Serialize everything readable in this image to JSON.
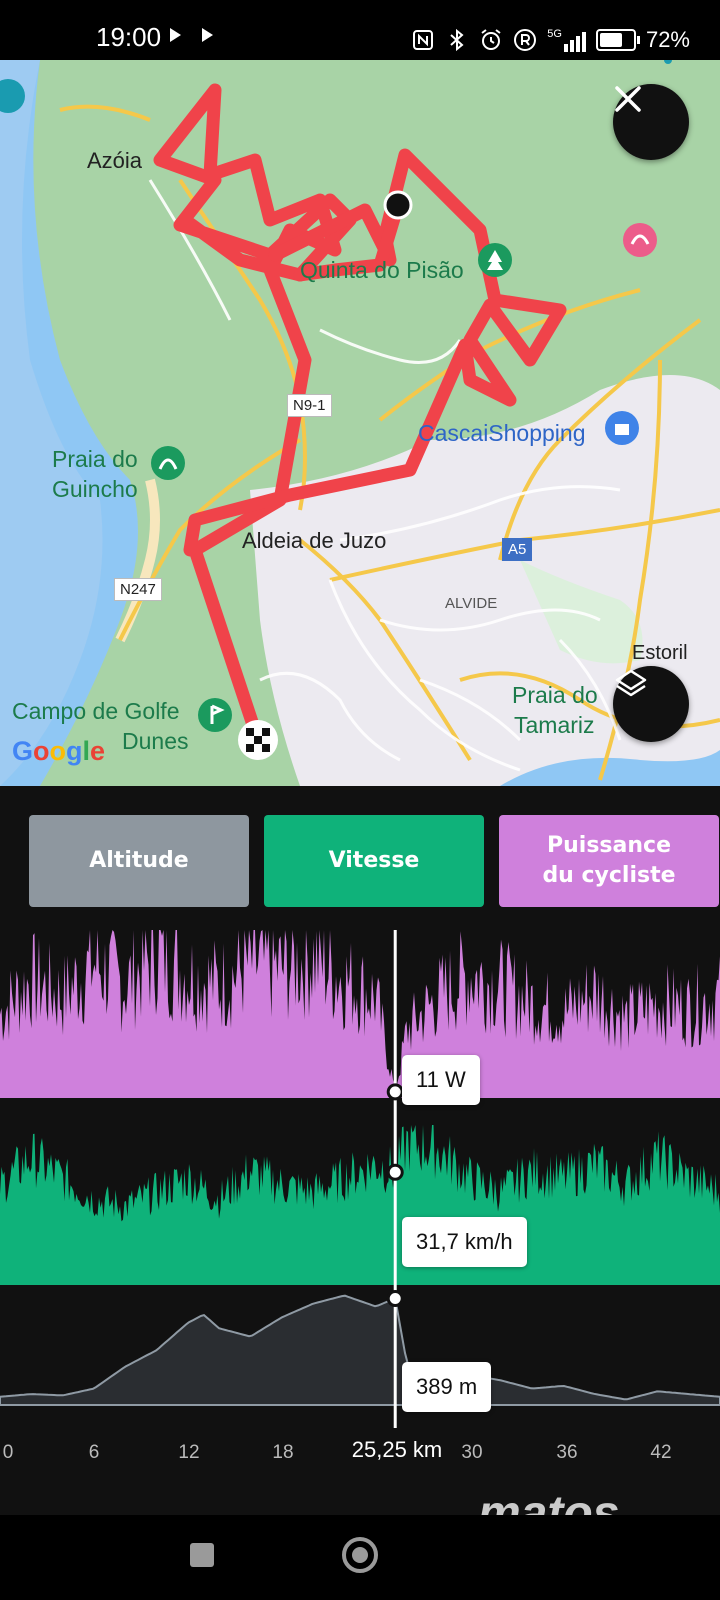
{
  "status_bar": {
    "time": "19:00",
    "icons": [
      "play-icon",
      "play-icon",
      "nfc-icon",
      "bluetooth-icon",
      "alarm-icon",
      "registered-icon",
      "signal-5g-icon",
      "battery-icon"
    ],
    "network": "5G",
    "battery_percent": "72%",
    "battery_level": 0.72
  },
  "map": {
    "places": {
      "azoia": "Azóia",
      "quinta": "Quinta do Pisão",
      "praia_guincho_1": "Praia do",
      "praia_guincho_2": "Guincho",
      "cascaishopping": "CascaiShopping",
      "aldeia": "Aldeia de Juzo",
      "alvide": "ALVIDE",
      "estoril": "Estoril",
      "praia_tamariz_1": "Praia do",
      "praia_tamariz_2": "Tamariz",
      "campo_golfe_1": "Campo de Golfe",
      "campo_golfe_2": "Dunes"
    },
    "roads": {
      "n9_1": "N9-1",
      "a5": "A5",
      "n247": "N247"
    },
    "attribution": "Google",
    "route_color": "#f0434a",
    "buttons": {
      "close": "close-icon",
      "layers": "layers-icon"
    }
  },
  "tabs": [
    {
      "label": "Altitude",
      "color": "#8e979f"
    },
    {
      "label": "Vitesse",
      "color": "#0fb27a"
    },
    {
      "label": "Puissance du cycliste",
      "color": "#cf80dc"
    }
  ],
  "charts": {
    "colors": {
      "power": "#cf80dc",
      "speed": "#0fb27a",
      "altitude": "#8f9aa4"
    },
    "x_ticks": [
      "0",
      "6",
      "12",
      "18",
      "30",
      "36",
      "42"
    ],
    "cursor_km": "25,25 km",
    "readouts": {
      "power": "11 W",
      "speed": "31,7 km/h",
      "altitude": "389 m"
    }
  },
  "chart_data": [
    {
      "type": "area",
      "name": "Puissance du cycliste",
      "x_unit": "km",
      "x": [
        0,
        2,
        4,
        6,
        8,
        10,
        12,
        14,
        16,
        18,
        20,
        22,
        24,
        25.25,
        26,
        28,
        30,
        32,
        34,
        36,
        38,
        40,
        42,
        44,
        46
      ],
      "values": [
        150,
        210,
        180,
        240,
        200,
        260,
        220,
        200,
        240,
        230,
        250,
        210,
        180,
        11,
        120,
        180,
        220,
        200,
        170,
        150,
        190,
        140,
        170,
        160,
        180
      ],
      "xlim": [
        0,
        46
      ]
    },
    {
      "type": "area",
      "name": "Vitesse",
      "x_unit": "km",
      "x": [
        0,
        2,
        4,
        6,
        8,
        10,
        12,
        14,
        16,
        18,
        20,
        22,
        24,
        25.25,
        26,
        28,
        30,
        32,
        34,
        36,
        38,
        40,
        42,
        44,
        46
      ],
      "values": [
        28,
        36,
        30,
        24,
        22,
        26,
        30,
        24,
        32,
        28,
        26,
        30,
        34,
        31.7,
        40,
        38,
        30,
        26,
        32,
        30,
        34,
        28,
        36,
        30,
        26
      ],
      "xlim": [
        0,
        46
      ]
    },
    {
      "type": "area",
      "name": "Altitude",
      "x_unit": "km",
      "x": [
        0,
        2,
        4,
        6,
        8,
        10,
        12,
        13,
        14,
        16,
        18,
        20,
        22,
        24,
        25.25,
        26,
        28,
        30,
        32,
        34,
        36,
        38,
        40,
        42,
        44,
        46
      ],
      "values": [
        30,
        40,
        35,
        60,
        140,
        200,
        300,
        330,
        280,
        250,
        320,
        370,
        400,
        360,
        389,
        150,
        80,
        110,
        90,
        60,
        70,
        40,
        20,
        50,
        40,
        30
      ],
      "xlim": [
        0,
        46
      ]
    }
  ]
}
